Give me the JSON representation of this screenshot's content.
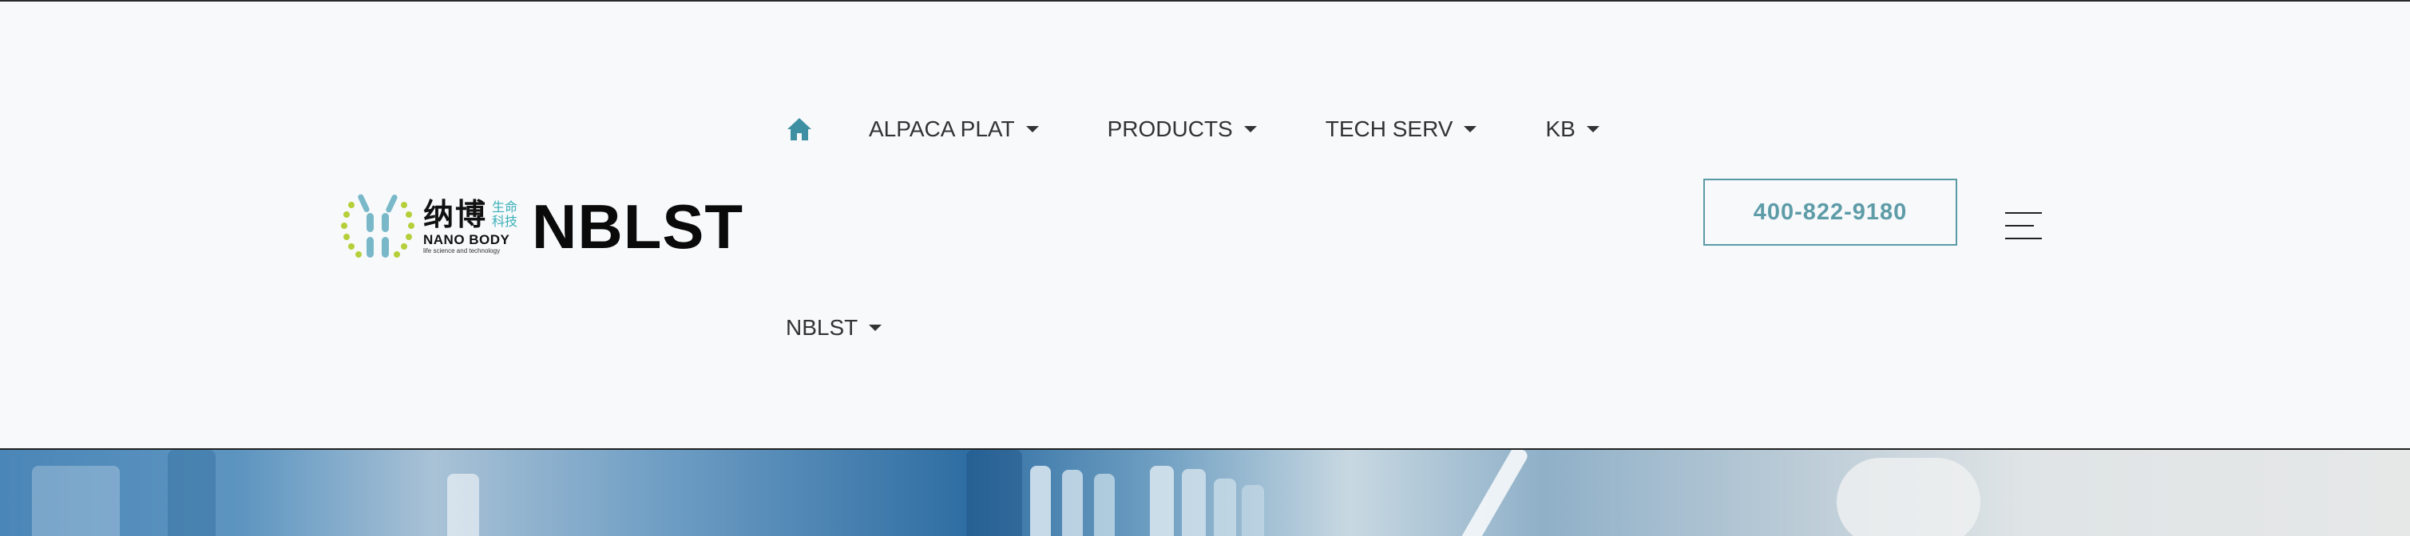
{
  "logo": {
    "cn": "纳博",
    "cn_small_1": "生命",
    "cn_small_2": "科技",
    "en": "NANO BODY",
    "tagline": "life science and technology",
    "brand": "NBLST"
  },
  "nav": {
    "home_icon": "home-icon",
    "items": [
      {
        "label": "ALPACA PLAT"
      },
      {
        "label": "PRODUCTS"
      },
      {
        "label": "TECH SERV"
      },
      {
        "label": "KB"
      }
    ],
    "second_row": [
      {
        "label": "NBLST"
      }
    ]
  },
  "contact": {
    "phone": "400-822-9180"
  },
  "menu_icon": "hamburger-menu-icon",
  "colors": {
    "accent": "#3f8fa3",
    "phone_border": "#5a9aa6",
    "logo_green": "#b5cf3a",
    "logo_blue": "#79b8c9"
  }
}
